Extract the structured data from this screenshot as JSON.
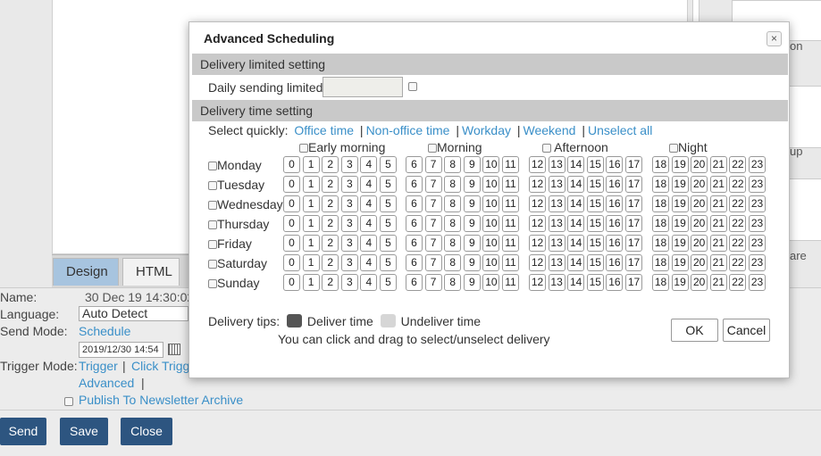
{
  "background": {
    "tabs": {
      "design": "Design",
      "html": "HTML"
    },
    "right_pane": {
      "text1": "on",
      "text2": "up",
      "text3": "are"
    },
    "form": {
      "name_label": "Name:",
      "name_value": "30 Dec 19 14:30:02",
      "language_label": "Language:",
      "language_value": "Auto Detect",
      "send_mode_label": "Send Mode:",
      "send_mode_link": "Schedule",
      "date_value": "2019/12/30 14:54",
      "trigger_label": "Trigger Mode:",
      "trigger_link": "Trigger",
      "trigger_sep": "|",
      "click_trigger": "Click Trigg",
      "advanced": "Advanced",
      "adv_sep": "|",
      "publish_label": "Publish To Newsletter Archive"
    },
    "buttons": {
      "send": "Send",
      "save": "Save",
      "close": "Close"
    }
  },
  "dialog": {
    "title": "Advanced Scheduling",
    "close_icon": "×",
    "limited_section": "Delivery limited setting",
    "daily_label": "Daily sending limited:",
    "daily_value": "",
    "time_section": "Delivery time setting",
    "quick_label": "Select quickly:",
    "quick_links": [
      "Office time",
      "Non-office time",
      "Workday",
      "Weekend",
      "Unselect all"
    ],
    "groups": [
      "Early morning",
      "Morning",
      "Afternoon",
      "Night"
    ],
    "days": [
      "Monday",
      "Tuesday",
      "Wednesday",
      "Thursday",
      "Friday",
      "Saturday",
      "Sunday"
    ],
    "hours": [
      "0",
      "1",
      "2",
      "3",
      "4",
      "5",
      "6",
      "7",
      "8",
      "9",
      "10",
      "11",
      "12",
      "13",
      "14",
      "15",
      "16",
      "17",
      "18",
      "19",
      "20",
      "21",
      "22",
      "23"
    ],
    "tips_label": "Delivery tips:",
    "deliver_label": "Deliver time",
    "undeliver_label": "Undeliver time",
    "tips_help": "You can click and drag to select/unselect delivery",
    "deliver_color": "#555555",
    "undeliver_color": "#d6d6d6",
    "ok_label": "OK",
    "cancel_label": "Cancel"
  }
}
